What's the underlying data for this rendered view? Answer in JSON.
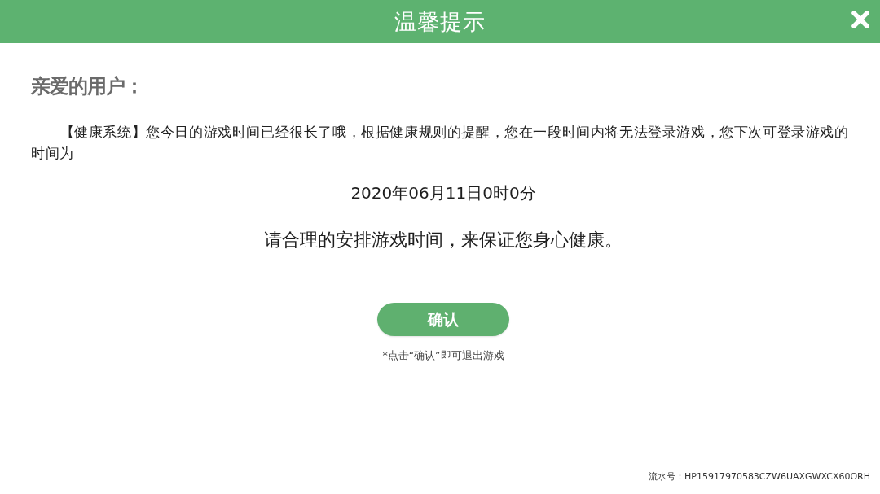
{
  "window": {
    "title": "温馨提示"
  },
  "greeting": "亲爱的用户：",
  "message": "【健康系统】您今日的游戏时间已经很长了哦，根据健康规则的提醒，您在一段时间内将无法登录游戏，您下次可登录游戏的时间为",
  "next_login_time": "2020年06月11日0时0分",
  "advice": "请合理的安排游戏时间，来保证您身心健康。",
  "confirm_button": {
    "label": "确认"
  },
  "exit_note": "*点击“确认”即可退出游戏",
  "serial": "流水号：HP15917970583CZW6UAXGWXCX60ORH"
}
